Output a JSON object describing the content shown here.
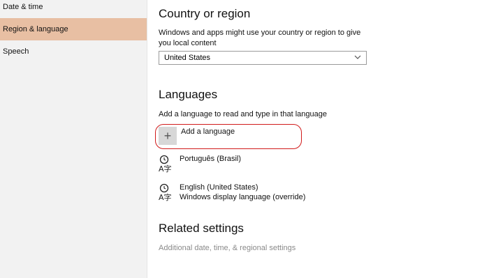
{
  "sidebar": {
    "items": [
      {
        "label": "Date & time"
      },
      {
        "label": "Region & language"
      },
      {
        "label": "Speech"
      }
    ]
  },
  "country": {
    "heading": "Country or region",
    "description": "Windows and apps might use your country or region to give you local content",
    "selected": "United States"
  },
  "languages": {
    "heading": "Languages",
    "description": "Add a language to read and type in that language",
    "add_label": "Add a language",
    "add_icon": "+",
    "items": [
      {
        "name": "Português (Brasil)",
        "detail": ""
      },
      {
        "name": "English (United States)",
        "detail": "Windows display language (override)"
      }
    ]
  },
  "related": {
    "heading": "Related settings",
    "link": "Additional date, time, & regional settings"
  },
  "colors": {
    "selected_nav": "#e8bfa3",
    "highlight": "#d11a1a",
    "sidebar_bg": "#f2f2f2"
  }
}
